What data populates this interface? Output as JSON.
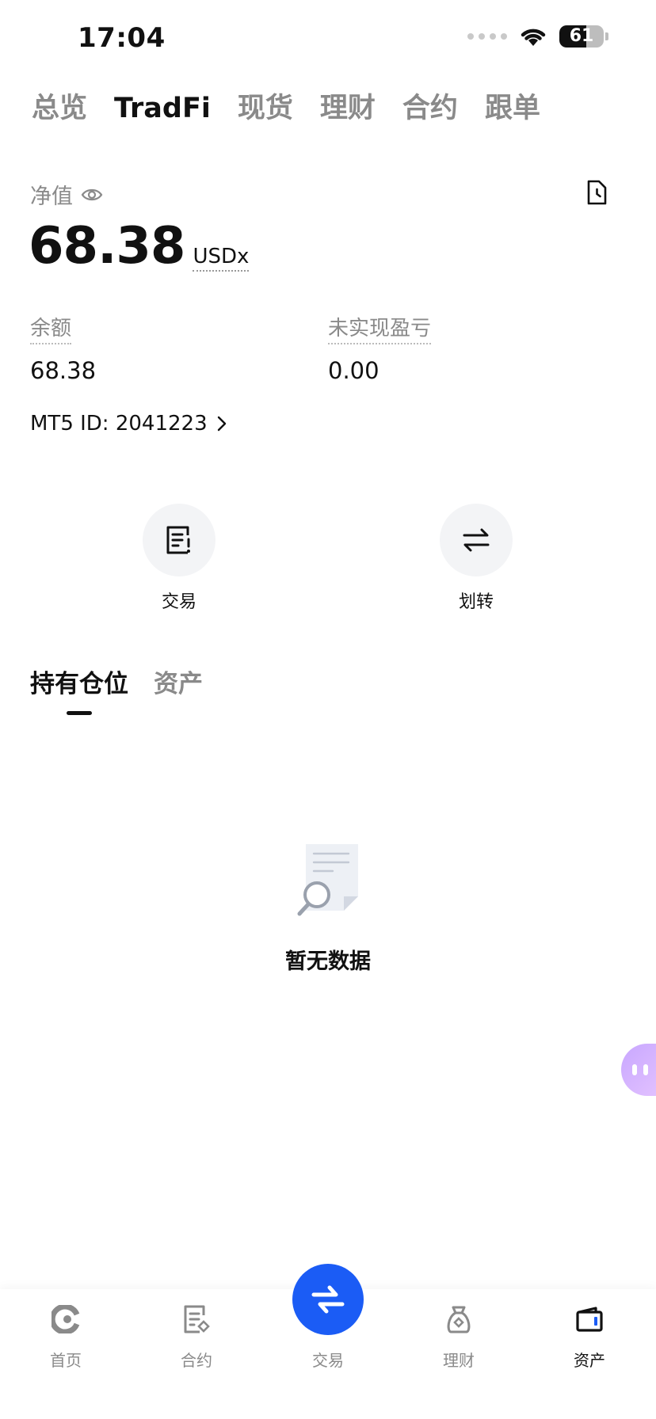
{
  "status_bar": {
    "time": "17:04",
    "battery": "61",
    "battery_level": 0.61
  },
  "top_tabs": [
    {
      "label": "总览",
      "active": false
    },
    {
      "label": "TradFi",
      "active": true
    },
    {
      "label": "现货",
      "active": false
    },
    {
      "label": "理财",
      "active": false
    },
    {
      "label": "合约",
      "active": false
    },
    {
      "label": "跟单",
      "active": false
    }
  ],
  "account": {
    "net_value_label": "净值",
    "net_value": "68.38",
    "unit": "USDx",
    "balance_label": "余额",
    "balance": "68.38",
    "unrealized_label": "未实现盈亏",
    "unrealized": "0.00",
    "mt5_id": "MT5 ID: 2041223"
  },
  "actions": [
    {
      "label": "交易",
      "icon": "order-list-icon"
    },
    {
      "label": "划转",
      "icon": "transfer-arrows-icon"
    }
  ],
  "position_tabs": [
    {
      "label": "持有仓位",
      "active": true
    },
    {
      "label": "资产",
      "active": false
    }
  ],
  "empty_state": {
    "text": "暂无数据",
    "icon": "empty-document-search-icon"
  },
  "bottom_nav": [
    {
      "label": "首页",
      "icon": "home-icon",
      "active": false
    },
    {
      "label": "合约",
      "icon": "contract-icon",
      "active": false
    },
    {
      "label": "交易",
      "icon": "swap-icon",
      "active": false
    },
    {
      "label": "理财",
      "icon": "finance-bag-icon",
      "active": false
    },
    {
      "label": "资产",
      "icon": "wallet-icon",
      "active": true
    }
  ],
  "colors": {
    "accent": "#1b5cf5",
    "muted": "#8a8a8a",
    "text": "#111111",
    "bubble": "#c8a7ff"
  }
}
